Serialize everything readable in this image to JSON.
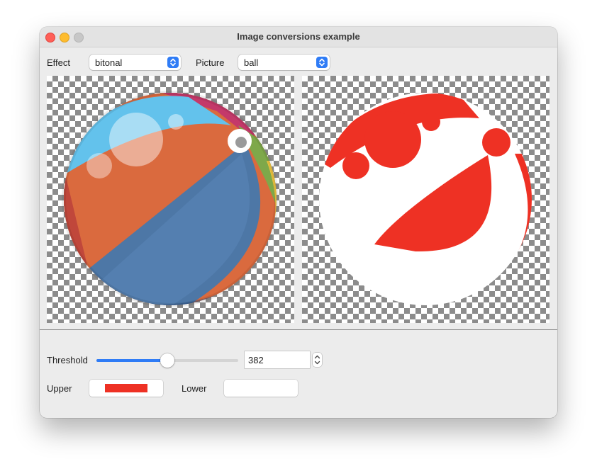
{
  "window": {
    "title": "Image conversions example"
  },
  "controls": {
    "effect_label": "Effect",
    "effect_value": "bitonal",
    "picture_label": "Picture",
    "picture_value": "ball"
  },
  "threshold": {
    "label": "Threshold",
    "value": "382",
    "slider_fraction": 0.5
  },
  "colors": {
    "upper_label": "Upper",
    "upper_color": "#ee3124",
    "lower_label": "Lower",
    "lower_color": "#ffffff"
  },
  "icons": {
    "popup_arrows": "up-down-chevron-icon",
    "stepper": "stepper-icon"
  }
}
